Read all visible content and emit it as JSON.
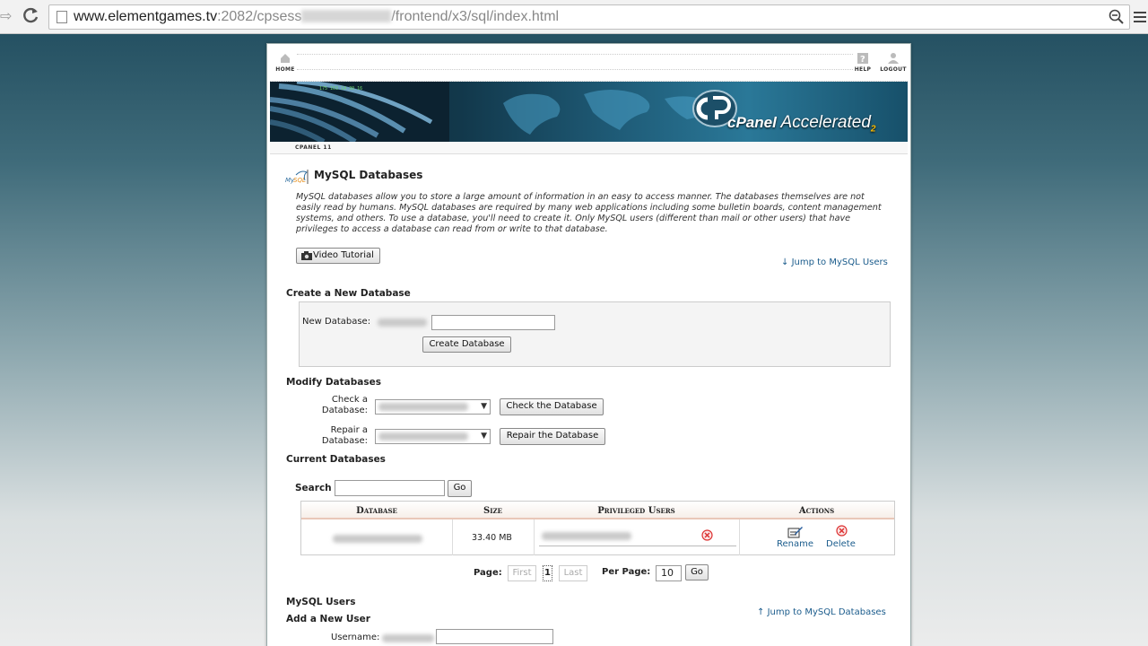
{
  "browser": {
    "url_host": "www.elementgames.tv",
    "url_port_path": ":2082/cpsess",
    "url_rest": "/frontend/x3/sql/index.html"
  },
  "nav": {
    "home": "HOME",
    "help": "HELP",
    "logout": "LOGOUT",
    "version": "CPANEL 11"
  },
  "banner": {
    "brand": "cPanel",
    "accelerated": "Accelerated",
    "sub": "2"
  },
  "page": {
    "title": "MySQL Databases",
    "intro": "MySQL databases allow you to store a large amount of information in an easy to access manner. The databases themselves are not easily read by humans. MySQL databases are required by many web applications including some bulletin boards, content management systems, and others. To use a database, you'll need to create it. Only MySQL users (different than mail or other users) that have privileges to access a database can read from or write to that database.",
    "video_tutorial": "Video Tutorial",
    "jump_users": "Jump to MySQL Users",
    "jump_databases": "Jump to MySQL Databases"
  },
  "create": {
    "heading": "Create a New Database",
    "label": "New Database:",
    "button": "Create Database"
  },
  "modify": {
    "heading": "Modify Databases",
    "check_label_1": "Check a",
    "check_label_2": "Database:",
    "check_button": "Check the Database",
    "repair_label_1": "Repair a",
    "repair_label_2": "Database:",
    "repair_button": "Repair the Database"
  },
  "current": {
    "heading": "Current Databases",
    "search_label": "Search",
    "go": "Go",
    "columns": [
      "Database",
      "Size",
      "Privileged Users",
      "Actions"
    ],
    "rows": [
      {
        "size": "33.40 MB",
        "rename": "Rename",
        "delete": "Delete"
      }
    ],
    "page_label": "Page:",
    "first": "First",
    "page_num": "1",
    "last": "Last",
    "per_page_label": "Per Page:",
    "per_page_value": "10"
  },
  "users": {
    "heading": "MySQL Users",
    "add_heading": "Add a New User",
    "username_label": "Username:"
  }
}
